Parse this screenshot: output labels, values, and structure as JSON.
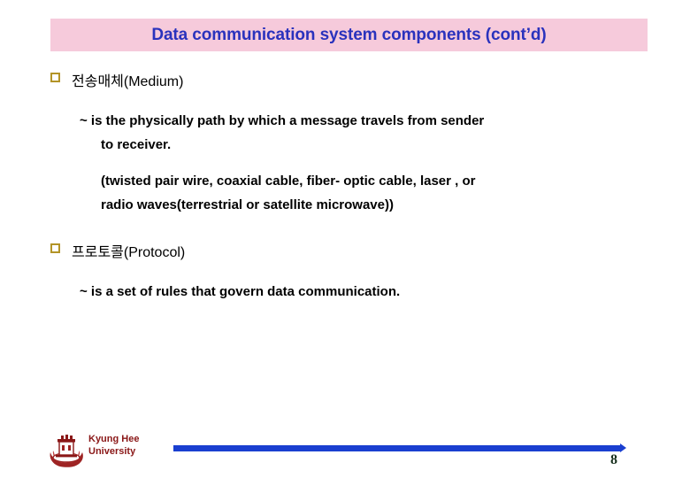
{
  "slide": {
    "title": "Data communication system components (cont’d)",
    "title_color": "#2a32bd",
    "title_bg_color": "#f6cadb",
    "page_number": "8"
  },
  "bullets": [
    {
      "glyph": "hollow-square-bullet",
      "label": "전송매체(Medium)",
      "lines": [
        "~ is the physically path by which a message travels from sender",
        "to receiver."
      ],
      "note_lines": [
        "(twisted pair wire, coaxial cable, fiber- optic cable, laser , or",
        "radio waves(terrestrial or satellite microwave))"
      ]
    },
    {
      "glyph": "hollow-square-bullet",
      "label": "프로토콜(Protocol)",
      "lines": [
        "~ is a set of rules that govern data communication."
      ],
      "note_lines": []
    }
  ],
  "footer": {
    "logo_name": "kyung-hee-university-crest",
    "logo_line1": "Kyung Hee",
    "logo_line2": "University",
    "logo_color": "#8a1717",
    "rule_color": "#1a3fd0"
  }
}
